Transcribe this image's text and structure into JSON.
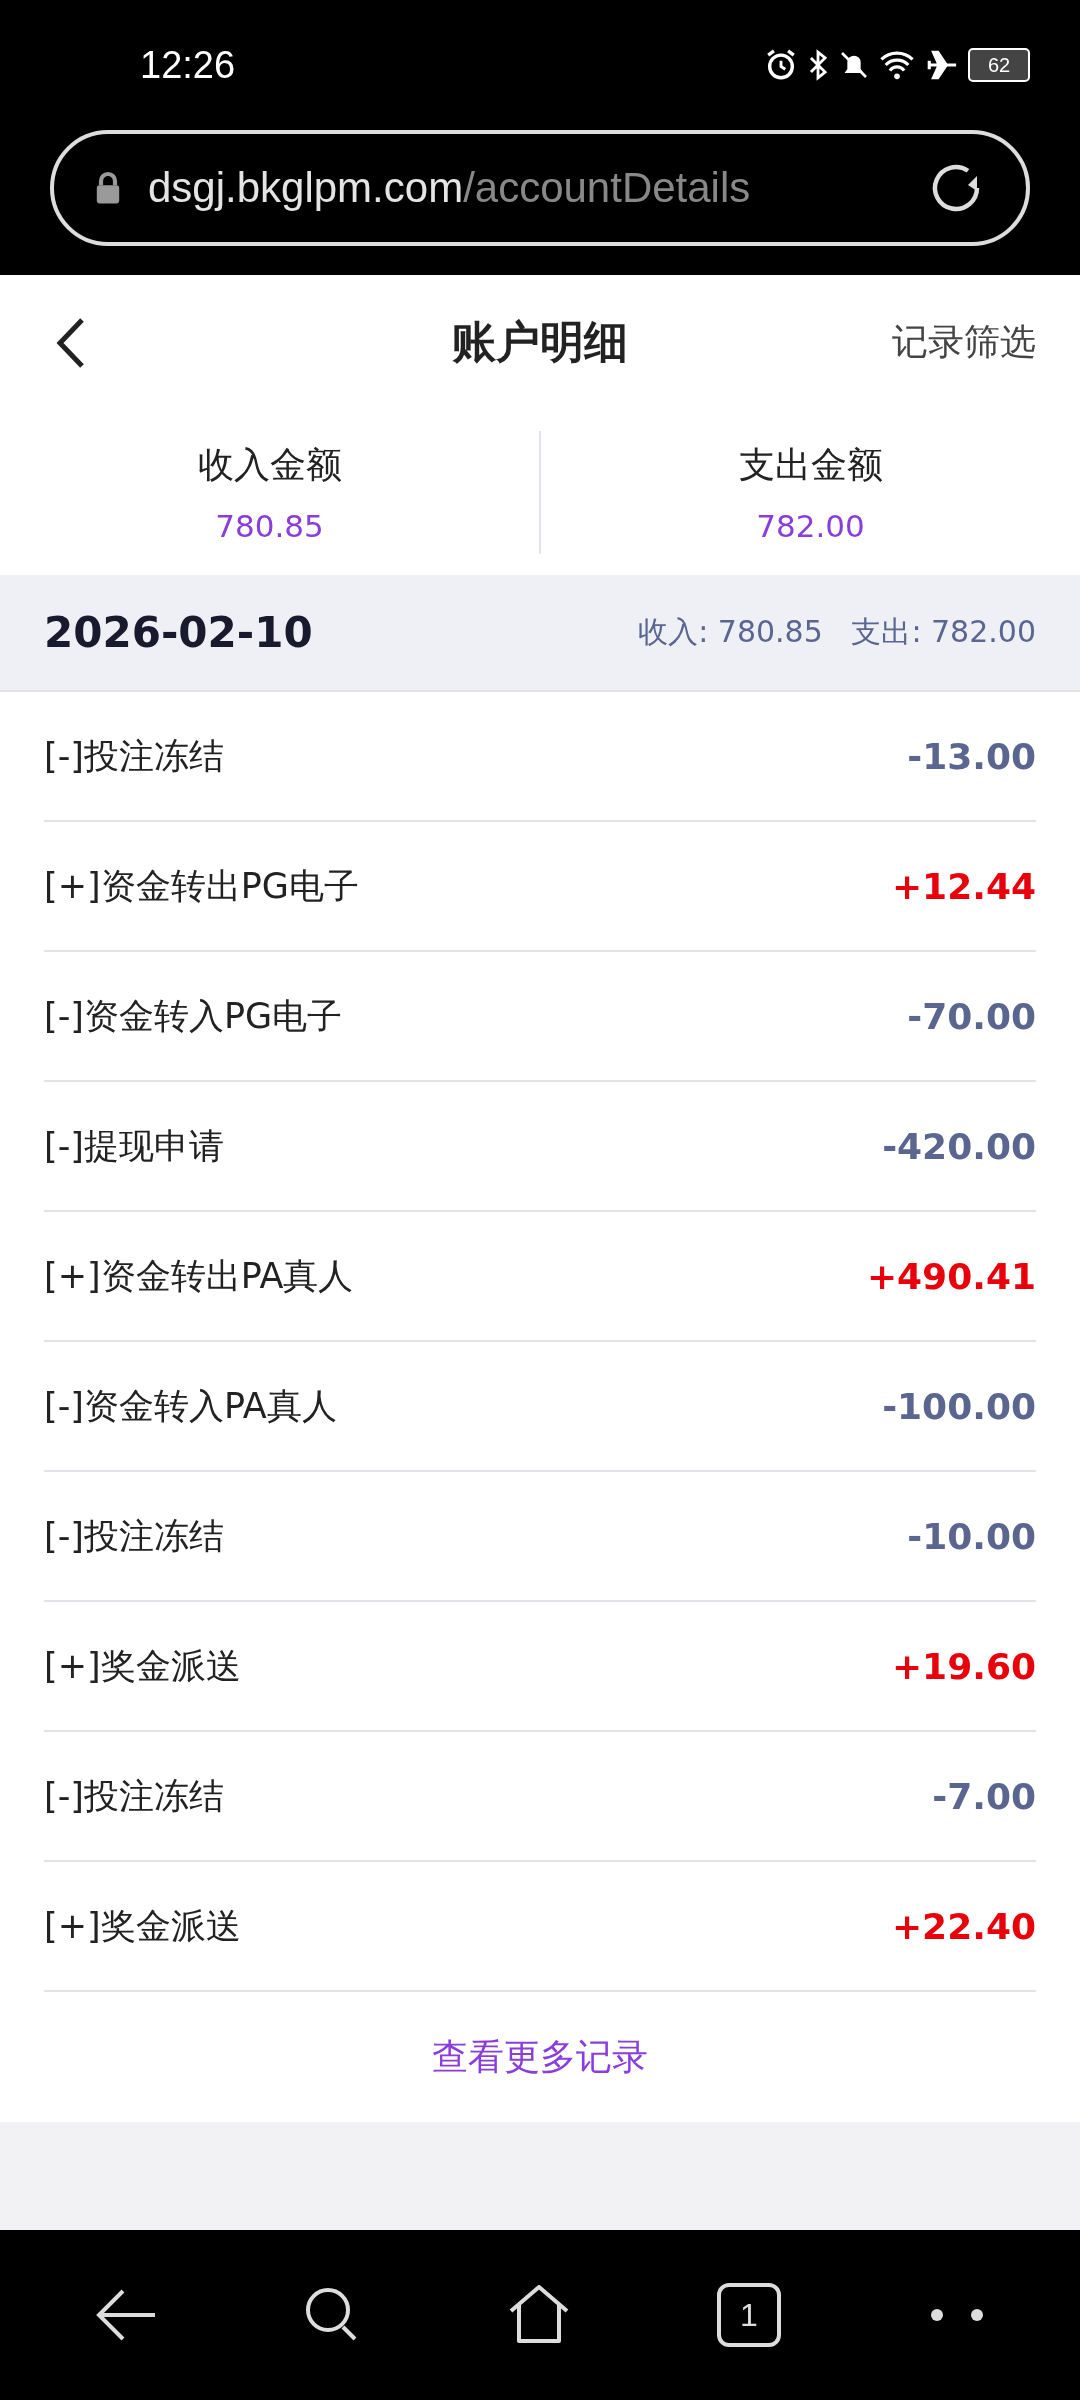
{
  "status_bar": {
    "time": "12:26",
    "battery": "62"
  },
  "browser": {
    "url_host": "dsgj.bkglpm.com",
    "url_path": "/accountDetails"
  },
  "header": {
    "title": "账户明细",
    "filter": "记录筛选"
  },
  "summary": [
    {
      "label": "收入金额",
      "value": "780.85"
    },
    {
      "label": "支出金额",
      "value": "782.00"
    }
  ],
  "day": {
    "date": "2026-02-10",
    "income_label": "收入:",
    "income": "780.85",
    "expense_label": "支出:",
    "expense": "782.00"
  },
  "rows": [
    {
      "label": "[-]投注冻结",
      "amount": "-13.00",
      "kind": "expense"
    },
    {
      "label": "[+]资金转出PG电子",
      "amount": "+12.44",
      "kind": "income"
    },
    {
      "label": "[-]资金转入PG电子",
      "amount": "-70.00",
      "kind": "expense"
    },
    {
      "label": "[-]提现申请",
      "amount": "-420.00",
      "kind": "expense"
    },
    {
      "label": "[+]资金转出PA真人",
      "amount": "+490.41",
      "kind": "income"
    },
    {
      "label": "[-]资金转入PA真人",
      "amount": "-100.00",
      "kind": "expense"
    },
    {
      "label": "[-]投注冻结",
      "amount": "-10.00",
      "kind": "expense"
    },
    {
      "label": "[+]奖金派送",
      "amount": "+19.60",
      "kind": "income"
    },
    {
      "label": "[-]投注冻结",
      "amount": "-7.00",
      "kind": "expense"
    },
    {
      "label": "[+]奖金派送",
      "amount": "+22.40",
      "kind": "income"
    }
  ],
  "more_link": "查看更多记录",
  "nav": {
    "tabs_count": "1"
  }
}
